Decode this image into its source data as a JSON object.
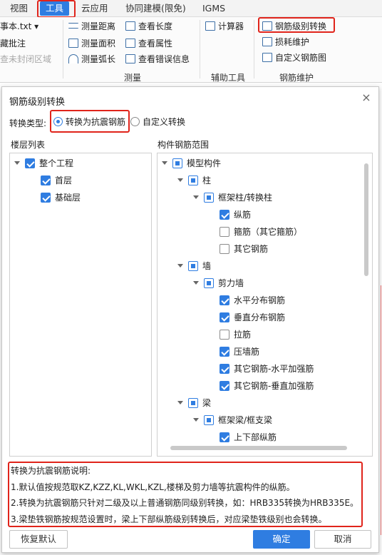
{
  "menu": {
    "tabs": [
      {
        "label": "视图",
        "active": false
      },
      {
        "label": "工具",
        "active": true
      },
      {
        "label": "云应用",
        "active": false
      },
      {
        "label": "协同建模(限免)",
        "active": false
      },
      {
        "label": "IGMS",
        "active": false
      }
    ]
  },
  "ribbon": {
    "left_items": [
      "事本.txt ▾",
      "藏批注",
      "查未封闭区域"
    ],
    "measure": {
      "items": [
        "测量距离",
        "测量面积",
        "测量弧长"
      ],
      "group_label": "测量"
    },
    "view": {
      "items": [
        "查看长度",
        "查看属性",
        "查看错误信息"
      ]
    },
    "aux": {
      "items": [
        "计算器"
      ],
      "group_label": "辅助工具"
    },
    "rebar": {
      "items": [
        "钢筋级别转换",
        "损耗维护",
        "自定义钢筋图"
      ],
      "group_label": "钢筋维护"
    }
  },
  "dialog": {
    "title": "钢筋级别转换",
    "close": "×",
    "conversion_label": "转换类型:",
    "options": [
      {
        "label": "转换为抗震钢筋",
        "selected": true
      },
      {
        "label": "自定义转换",
        "selected": false
      }
    ],
    "floor_panel": {
      "caption": "楼层列表",
      "items": [
        {
          "label": "整个工程",
          "state": "checked",
          "level": 0,
          "expander": true
        },
        {
          "label": "首层",
          "state": "checked",
          "level": 1,
          "expander": false
        },
        {
          "label": "基础层",
          "state": "checked",
          "level": 1,
          "expander": false
        }
      ]
    },
    "component_panel": {
      "caption": "构件钢筋范围",
      "items": [
        {
          "label": "模型构件",
          "state": "partial",
          "level": 0,
          "expander": true
        },
        {
          "label": "柱",
          "state": "partial",
          "level": 1,
          "expander": true
        },
        {
          "label": "框架柱/转换柱",
          "state": "partial",
          "level": 2,
          "expander": true
        },
        {
          "label": "纵筋",
          "state": "checked",
          "level": 3,
          "expander": false
        },
        {
          "label": "箍筋（其它箍筋）",
          "state": "unchecked",
          "level": 3,
          "expander": false
        },
        {
          "label": "其它钢筋",
          "state": "unchecked",
          "level": 3,
          "expander": false
        },
        {
          "label": "墙",
          "state": "partial",
          "level": 1,
          "expander": true
        },
        {
          "label": "剪力墙",
          "state": "partial",
          "level": 2,
          "expander": true
        },
        {
          "label": "水平分布钢筋",
          "state": "checked",
          "level": 3,
          "expander": false
        },
        {
          "label": "垂直分布钢筋",
          "state": "checked",
          "level": 3,
          "expander": false
        },
        {
          "label": "拉筋",
          "state": "unchecked",
          "level": 3,
          "expander": false
        },
        {
          "label": "压墙筋",
          "state": "checked",
          "level": 3,
          "expander": false
        },
        {
          "label": "其它钢筋-水平加强筋",
          "state": "checked",
          "level": 3,
          "expander": false
        },
        {
          "label": "其它钢筋-垂直加强筋",
          "state": "checked",
          "level": 3,
          "expander": false
        },
        {
          "label": "梁",
          "state": "partial",
          "level": 1,
          "expander": true
        },
        {
          "label": "框架梁/框支梁",
          "state": "partial",
          "level": 2,
          "expander": true
        },
        {
          "label": "上下部纵筋",
          "state": "checked",
          "level": 3,
          "expander": false
        }
      ]
    },
    "notes": {
      "title": "转换为抗震钢筋说明:",
      "lines": [
        "1.默认值按规范取KZ,KZZ,KL,WKL,KZL,楼梯及剪力墙等抗震构件的纵筋。",
        "2.转换为抗震钢筋只针对二级及以上普通钢筋同级别转换，如：HRB335转换为HRB335E。",
        "3.梁垫铁钢筋按规范设置时，梁上下部纵筋级别转换后，对应梁垫铁级别也会转换。"
      ]
    },
    "buttons": {
      "restore": "恢复默认",
      "ok": "确定",
      "cancel": "取消"
    }
  },
  "colors": {
    "accent": "#2f7de1",
    "highlight_box": "#e0241b"
  }
}
